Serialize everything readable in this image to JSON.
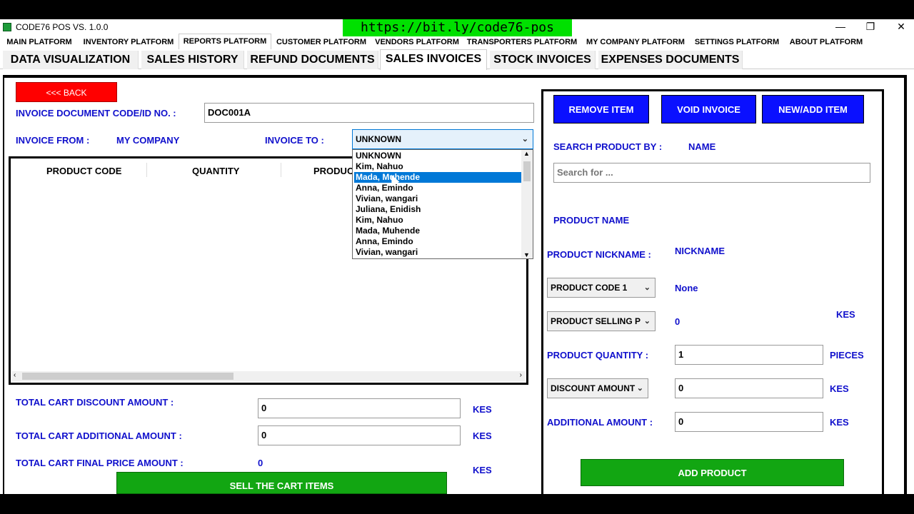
{
  "window": {
    "title": "CODE76 POS VS. 1.0.0",
    "banner_url": "https://bit.ly/code76-pos",
    "minimize": "—",
    "restore": "❐",
    "close": "✕"
  },
  "main_tabs": [
    {
      "label": "MAIN PLATFORM"
    },
    {
      "label": "INVENTORY PLATFORM"
    },
    {
      "label": "REPORTS PLATFORM"
    },
    {
      "label": "CUSTOMER PLATFORM"
    },
    {
      "label": "VENDORS PLATFORM"
    },
    {
      "label": "TRANSPORTERS PLATFORM"
    },
    {
      "label": "MY COMPANY PLATFORM"
    },
    {
      "label": "SETTINGS PLATFORM"
    },
    {
      "label": "ABOUT PLATFORM"
    }
  ],
  "active_main_tab": "REPORTS PLATFORM",
  "sub_tabs": [
    {
      "label": "DATA VISUALIZATION"
    },
    {
      "label": "SALES HISTORY"
    },
    {
      "label": "REFUND DOCUMENTS"
    },
    {
      "label": "SALES INVOICES"
    },
    {
      "label": "STOCK INVOICES"
    },
    {
      "label": "EXPENSES DOCUMENTS"
    }
  ],
  "active_sub_tab": "SALES INVOICES",
  "invoice": {
    "back_label": "<<< BACK",
    "doc_code_label": "INVOICE DOCUMENT CODE/ID NO. :",
    "doc_code_value": "DOC001A",
    "from_label": "INVOICE FROM   :",
    "from_value": "MY COMPANY",
    "to_label": "INVOICE TO   :",
    "to_value": "UNKNOWN",
    "to_options": [
      "UNKNOWN",
      "Kim, Nahuo",
      "Mada, Muhende",
      "Anna, Emindo",
      "Vivian, wangari",
      "Juliana, Enidish",
      "Kim, Nahuo",
      "Mada, Muhende",
      "Anna, Emindo",
      "Vivian, wangari"
    ],
    "to_highlighted": "Mada, Muhende"
  },
  "cart": {
    "columns": [
      "PRODUCT CODE",
      "QUANTITY",
      "PRODUCT"
    ],
    "discount_label": "TOTAL CART  DISCOUNT AMOUNT  :",
    "discount_value": "0",
    "additional_label": "TOTAL CART  ADDITIONAL AMOUNT  :",
    "additional_value": "0",
    "final_label": "TOTAL CART FINAL PRICE AMOUNT  :",
    "final_value": "0",
    "currency": "KES",
    "sell_label": "SELL THE CART ITEMS"
  },
  "product": {
    "remove_label": "REMOVE ITEM",
    "void_label": "VOID INVOICE",
    "new_label": "NEW/ADD ITEM",
    "search_by_label": "SEARCH PRODUCT BY :",
    "search_by_value": "NAME",
    "search_placeholder": "Search for ...",
    "name_label": "PRODUCT NAME",
    "nickname_label": "PRODUCT NICKNAME :",
    "nickname_value": "NICKNAME",
    "code_select": "PRODUCT CODE 1",
    "code_value": "None",
    "price_select": "PRODUCT SELLING P",
    "price_value": "0",
    "price_currency": "KES",
    "quantity_label": "PRODUCT QUANTITY :",
    "quantity_value": "1",
    "quantity_unit": "PIECES",
    "discount_select": "DISCOUNT AMOUNT",
    "discount_value": "0",
    "discount_currency": "KES",
    "additional_label": "ADDITIONAL AMOUNT :",
    "additional_value": "0",
    "additional_currency": "KES",
    "add_label": "ADD PRODUCT"
  },
  "colors": {
    "accent_blue": "#1010cc",
    "button_blue": "#0a10ff",
    "button_green": "#12a612",
    "button_red": "#ff0000",
    "banner_green": "#00e000"
  }
}
